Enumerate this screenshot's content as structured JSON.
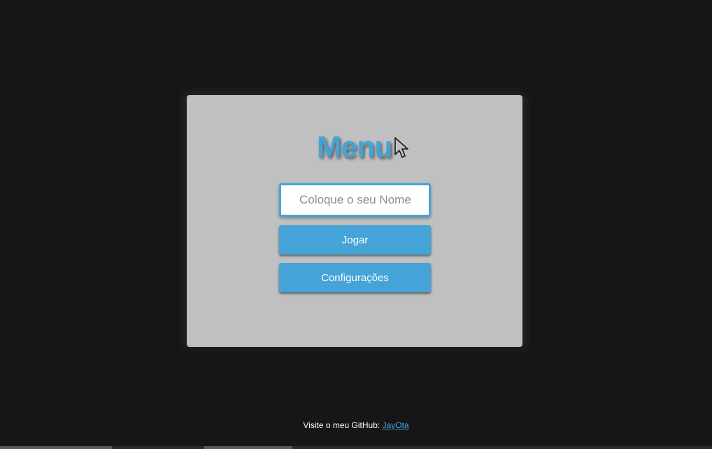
{
  "menu": {
    "title": "Menu",
    "name_input": {
      "value": "",
      "placeholder": "Coloque o seu Nome"
    },
    "play_label": "Jogar",
    "settings_label": "Configurações"
  },
  "footer": {
    "text": "Visite o meu GitHub: ",
    "link_text": "JayOta"
  },
  "colors": {
    "background": "#161616",
    "card": "#c0c0c0",
    "accent": "#44a4d8",
    "button_text": "#ffffff"
  },
  "icons": {
    "cursor": "mouse-pointer-icon"
  }
}
